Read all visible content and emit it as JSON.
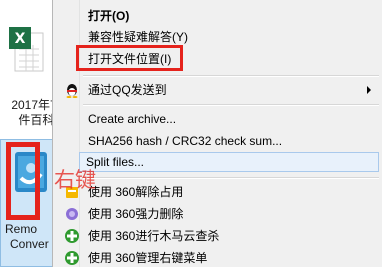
{
  "desktop": {
    "excel_file": {
      "label_line1": "2017年7",
      "label_line2": "件百科.",
      "icon": "excel-file-icon"
    },
    "exe_file": {
      "label_line1": "Remo",
      "label_line2": "Conver",
      "icon": "app-exe-icon"
    },
    "overlay_text": "右键"
  },
  "menu": {
    "items": [
      {
        "label": "打开(O)"
      },
      {
        "label": "兼容性疑难解答(Y)"
      },
      {
        "label": "打开文件位置(I)"
      },
      {
        "label": "通过QQ发送到",
        "icon": "qq-penguin-icon"
      },
      {
        "label": "Create archive..."
      },
      {
        "label": "SHA256 hash / CRC32 check sum..."
      },
      {
        "label": "Split files..."
      },
      {
        "label": "使用 360解除占用",
        "icon": "360-unlock-icon"
      },
      {
        "label": "使用 360强力删除",
        "icon": "360-delete-icon"
      },
      {
        "label": "使用 360进行木马云查杀",
        "icon": "360-scan-icon"
      },
      {
        "label": "使用 360管理右键菜单",
        "icon": "360-menu-icon"
      }
    ]
  },
  "colors": {
    "highlight_red": "#e5231c",
    "menu_bg": "#f0f0f0",
    "hover_bg": "#e8f1fb",
    "selection_bg": "#cfe6f8"
  }
}
